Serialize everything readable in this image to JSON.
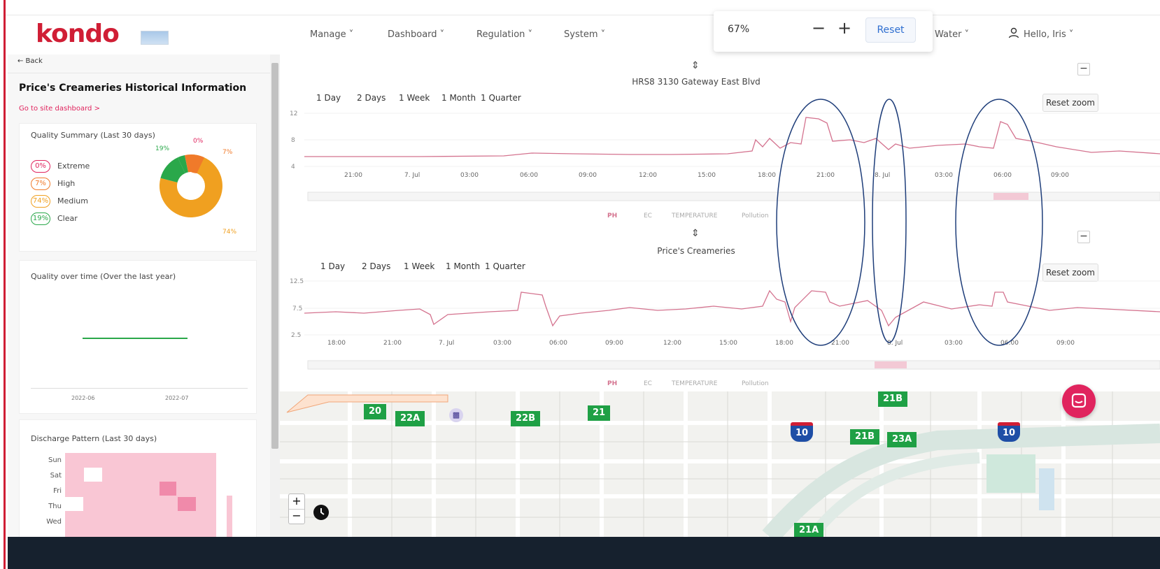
{
  "header": {
    "logo": "kondo",
    "nav": [
      "Manage ˅",
      "Dashboard ˅",
      "Regulation ˅",
      "System ˅",
      "Water ˅"
    ],
    "user": "Hello, Iris ˅"
  },
  "zoom_panel": {
    "value": "67%",
    "minus": "−",
    "plus": "+",
    "reset": "Reset"
  },
  "sidebar": {
    "back": "← Back",
    "title": "Price's Creameries Historical Information",
    "dashboard_link": "Go to site dashboard >",
    "quality_summary": {
      "title": "Quality Summary (Last 30 days)",
      "rows": [
        {
          "pct": "0%",
          "label": "Extreme",
          "color": "#e0245e"
        },
        {
          "pct": "7%",
          "label": "High",
          "color": "#f07a2a"
        },
        {
          "pct": "74%",
          "label": "Medium",
          "color": "#f0a020"
        },
        {
          "pct": "19%",
          "label": "Clear",
          "color": "#2aa84a"
        }
      ],
      "donut_labels": {
        "extreme": "0%",
        "high": "7%",
        "medium": "74%",
        "clear": "19%"
      }
    },
    "quality_over_time": {
      "title": "Quality over time (Over the last year)",
      "x_labels": [
        "2022-06",
        "2022-07"
      ]
    },
    "discharge": {
      "title": "Discharge Pattern (Last 30 days)",
      "days": [
        "Sun",
        "Sat",
        "Fri",
        "Thu",
        "Wed"
      ]
    }
  },
  "chart1": {
    "title": "HRS8 3130 Gateway East Blvd",
    "ranges": [
      "1 Day",
      "2 Days",
      "1 Week",
      "1 Month",
      "1 Quarter"
    ],
    "reset_zoom": "Reset zoom",
    "y_ticks": [
      "12",
      "8",
      "4"
    ],
    "x_ticks": [
      "21:00",
      "7. Jul",
      "03:00",
      "06:00",
      "09:00",
      "12:00",
      "15:00",
      "18:00",
      "21:00",
      "8. Jul",
      "03:00",
      "06:00",
      "09:00"
    ],
    "legend": [
      "PH",
      "EC",
      "TEMPERATURE",
      "Pollution"
    ],
    "ph_color": "#d4738f"
  },
  "chart2": {
    "title": "Price's Creameries",
    "ranges": [
      "1 Day",
      "2 Days",
      "1 Week",
      "1 Month",
      "1 Quarter"
    ],
    "reset_zoom": "Reset zoom",
    "y_ticks": [
      "12.5",
      "7.5",
      "2.5"
    ],
    "x_ticks": [
      "18:00",
      "21:00",
      "7. Jul",
      "03:00",
      "06:00",
      "09:00",
      "12:00",
      "15:00",
      "18:00",
      "21:00",
      "8. Jul",
      "03:00",
      "06:00",
      "09:00"
    ],
    "legend": [
      "PH",
      "EC",
      "TEMPERATURE",
      "Pollution"
    ]
  },
  "map": {
    "exits": [
      "20",
      "22A",
      "22B",
      "21",
      "21B",
      "21B",
      "23A",
      "21A"
    ],
    "interstate": [
      "10",
      "10"
    ],
    "zoom_in": "+",
    "zoom_out": "−"
  }
}
